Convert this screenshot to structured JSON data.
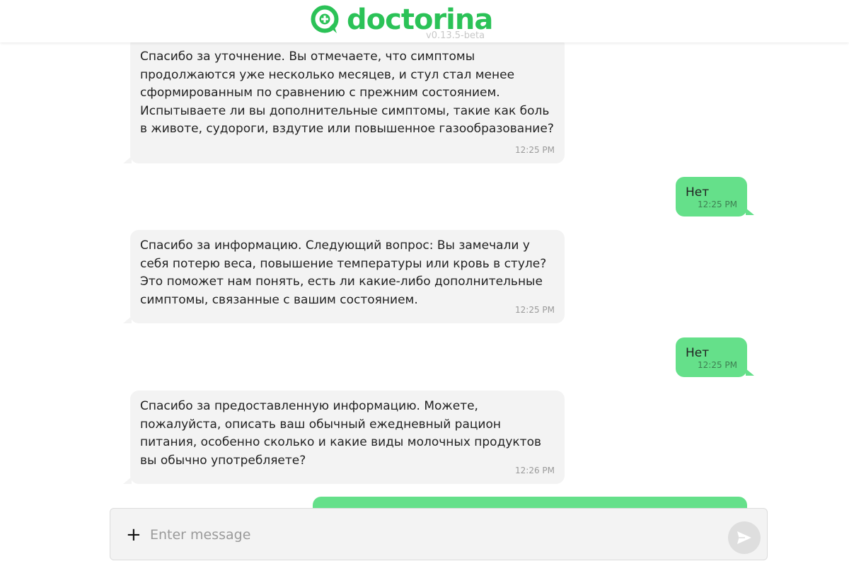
{
  "brand": {
    "name": "doctorina",
    "version": "v0.13.5-beta",
    "color": "#2bc257"
  },
  "messages": [
    {
      "role": "bot",
      "text": "Спасибо за уточнение. Вы отмечаете, что симптомы продолжаются уже несколько месяцев, и стул стал менее сформированным по сравнению с прежним состоянием. Испытываете ли вы дополнительные симптомы, такие как боль в животе, судороги, вздутие или повышенное газообразование?",
      "time": "12:25 PM"
    },
    {
      "role": "user",
      "text": "Нет",
      "time": "12:25 PM"
    },
    {
      "role": "bot",
      "text": "Спасибо за информацию. Следующий вопрос: Вы замечали у себя потерю веса, повышение температуры или кровь в стуле? Это поможет нам понять, есть ли какие-либо дополнительные симптомы, связанные с вашим состоянием.",
      "time": "12:25 PM"
    },
    {
      "role": "user",
      "text": "Нет",
      "time": "12:25 PM"
    },
    {
      "role": "bot",
      "text": "Спасибо за предоставленную информацию. Можете, пожалуйста, описать ваш обычный ежедневный рацион питания, особенно сколько и какие виды молочных продуктов вы обычно употребляете?",
      "time": "12:26 PM"
    }
  ],
  "composer": {
    "placeholder": "Enter message",
    "value": "",
    "attach_icon": "plus-icon",
    "send_icon": "send-icon"
  },
  "colors": {
    "bot_bubble": "#f3f3f3",
    "user_bubble": "#65e08a"
  }
}
